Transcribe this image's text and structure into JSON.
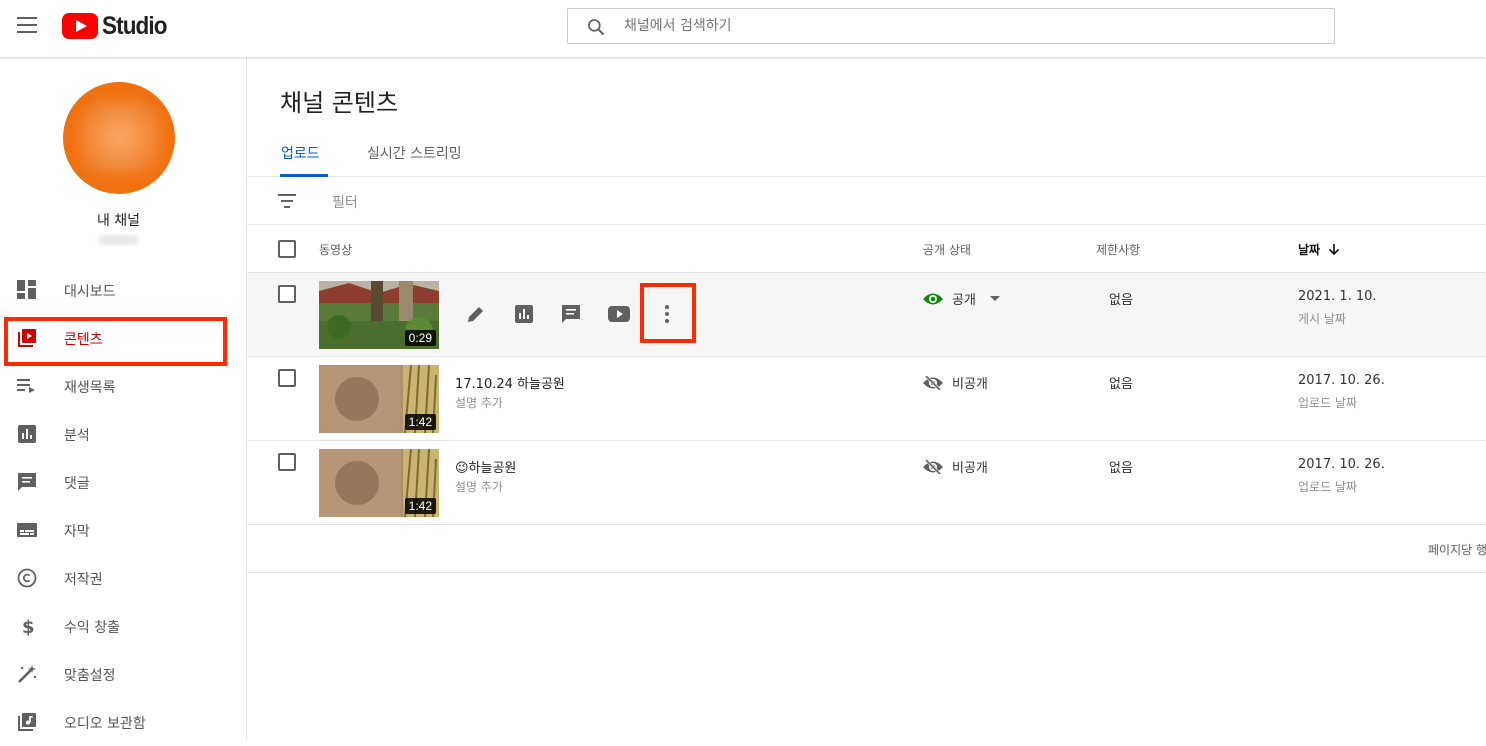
{
  "app": {
    "logo_text": "Studio"
  },
  "search": {
    "placeholder": "채널에서 검색하기"
  },
  "channel": {
    "name": "내 채널"
  },
  "sidebar": {
    "items": [
      {
        "label": "대시보드",
        "icon": "dashboard-icon"
      },
      {
        "label": "콘텐츠",
        "icon": "content-icon",
        "active": true
      },
      {
        "label": "재생목록",
        "icon": "playlist-icon"
      },
      {
        "label": "분석",
        "icon": "analytics-icon"
      },
      {
        "label": "댓글",
        "icon": "comments-icon"
      },
      {
        "label": "자막",
        "icon": "subtitles-icon"
      },
      {
        "label": "저작권",
        "icon": "copyright-icon"
      },
      {
        "label": "수익 창출",
        "icon": "monetization-icon"
      },
      {
        "label": "맞춤설정",
        "icon": "customization-icon"
      },
      {
        "label": "오디오 보관함",
        "icon": "audio-library-icon"
      }
    ]
  },
  "main": {
    "title": "채널 콘텐츠",
    "tabs": [
      {
        "label": "업로드",
        "active": true
      },
      {
        "label": "실시간 스트리밍"
      }
    ],
    "filter_label": "필터",
    "columns": {
      "video": "동영상",
      "visibility": "공개 상태",
      "restrictions": "제한사항",
      "date": "날짜"
    },
    "rows": [
      {
        "title": "",
        "description": "",
        "duration": "0:29",
        "visibility": "공개",
        "visibility_icon": "eye-icon",
        "restrictions": "없음",
        "date": "2021. 1. 10.",
        "date_label": "게시 날짜"
      },
      {
        "title": "17.10.24 하늘공원",
        "description": "설명 추가",
        "duration": "1:42",
        "visibility": "비공개",
        "visibility_icon": "eye-off-icon",
        "restrictions": "없음",
        "date": "2017. 10. 26.",
        "date_label": "업로드 날짜"
      },
      {
        "title": "😉하늘공원",
        "description": "설명 추가",
        "duration": "1:42",
        "visibility": "비공개",
        "visibility_icon": "eye-off-icon",
        "restrictions": "없음",
        "date": "2017. 10. 26.",
        "date_label": "업로드 날짜"
      }
    ],
    "footer": {
      "per_page_label": "페이지당 행"
    }
  },
  "colors": {
    "brand_red": "#ff0000",
    "highlight": "#ff2a00",
    "accent_blue": "#065fd4",
    "public_green": "#0f8a0f"
  }
}
